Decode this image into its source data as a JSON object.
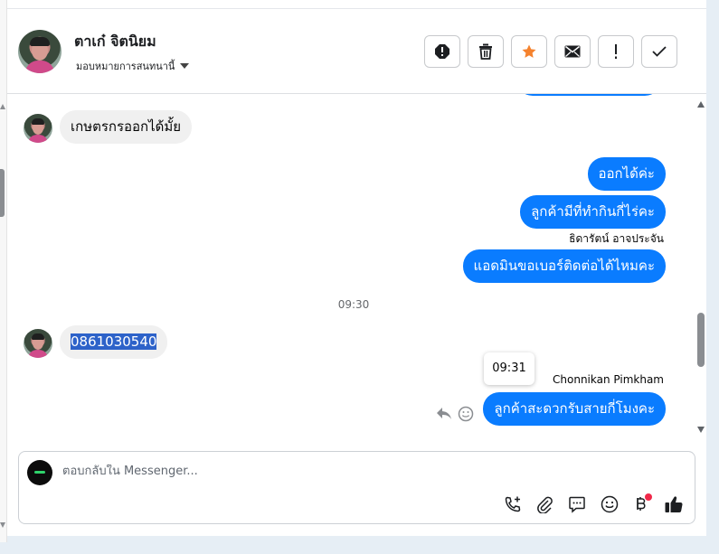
{
  "header": {
    "contact_name": "ตาเก๋ จิตนิยม",
    "assign_label": "มอบหมายการสนทนานี้",
    "toolbar_icons": [
      "report-icon",
      "trash-icon",
      "star-icon",
      "mail-icon",
      "exclamation-icon",
      "check-icon"
    ]
  },
  "colors": {
    "accent": "#0a7cff",
    "star": "#f5822d",
    "incoming_bubble": "#f0f0f0",
    "badge": "#f02849"
  },
  "messages": {
    "m1_in": "เกษตรกรออกได้มั้ย",
    "m2_out": "ออกได้ค่ะ",
    "m3_out": "ลูกค้ามีที่ทำกินกี่ไร่คะ",
    "m4_sender": "ธิดารัตน์ อาจประจัน",
    "m5_out": "แอดมินขอเบอร์ติดต่อได้ไหมคะ",
    "time_divider": "09:30",
    "m6_in": "0861030540",
    "tooltip_time": "09:31",
    "m7_sender": "Chonnikan Pimkham",
    "m8_out": "ลูกค้าสะดวกรับสายกี่โมงคะ"
  },
  "composer": {
    "placeholder": "ตอบกลับใน Messenger...",
    "tools": [
      "call-plus-icon",
      "attachment-icon",
      "saved-reply-icon",
      "emoji-icon",
      "payment-icon",
      "like-icon"
    ]
  }
}
